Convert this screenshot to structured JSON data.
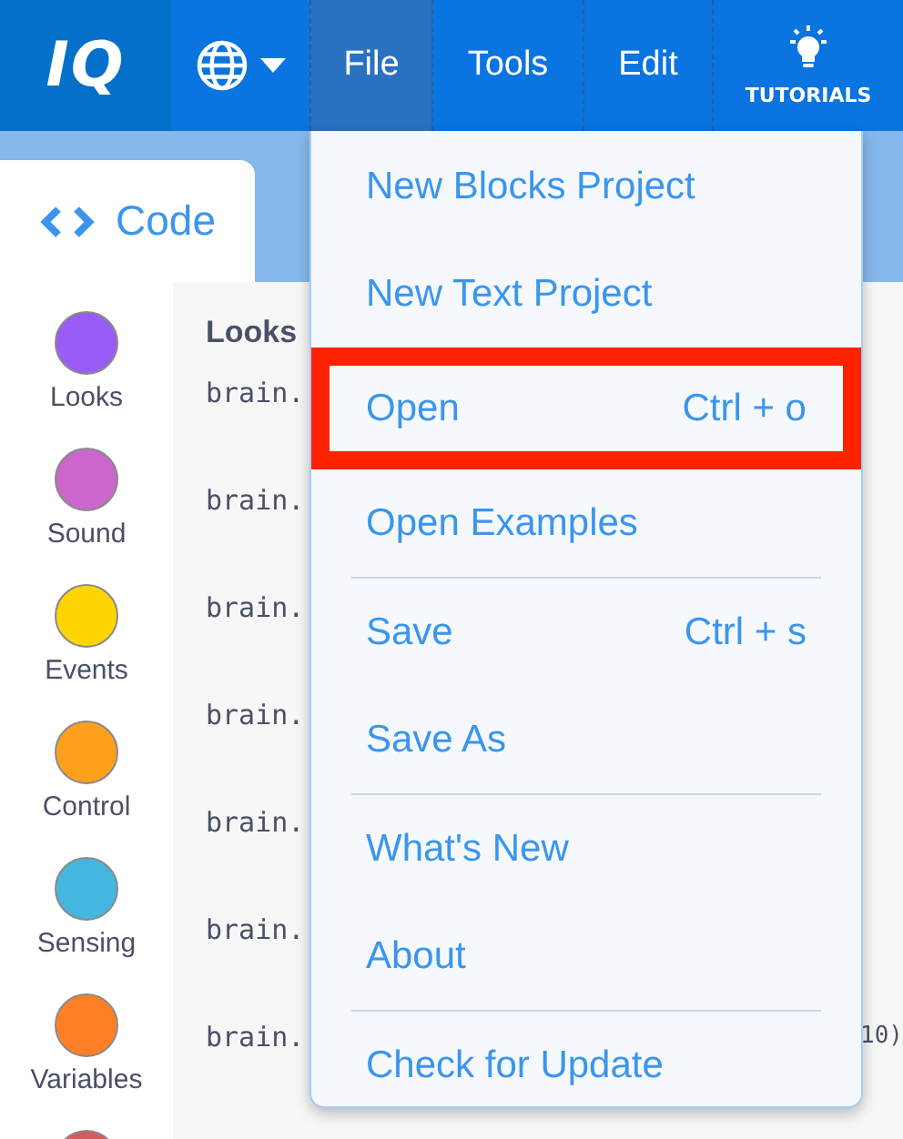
{
  "top_bar": {
    "logo": "IQ",
    "menus": [
      {
        "label": "File",
        "selected": true
      },
      {
        "label": "Tools",
        "selected": false
      },
      {
        "label": "Edit",
        "selected": false
      }
    ],
    "tutorials": "TUTORIALS"
  },
  "code_tab": {
    "label": "Code"
  },
  "categories": [
    {
      "label": "Looks",
      "color": "#9a5cf7"
    },
    {
      "label": "Sound",
      "color": "#cc66cc"
    },
    {
      "label": "Events",
      "color": "#ffd500"
    },
    {
      "label": "Control",
      "color": "#ffa01c"
    },
    {
      "label": "Sensing",
      "color": "#44b6e0"
    },
    {
      "label": "Variables",
      "color": "#ff8024"
    },
    {
      "color": "#d65c5c"
    }
  ],
  "code_panel": {
    "heading": "Looks",
    "lines": [
      {
        "start": "brain."
      },
      {
        "start": "brain."
      },
      {
        "start": "brain."
      },
      {
        "start": "brain."
      },
      {
        "start": "brain."
      },
      {
        "start": "brain."
      },
      {
        "start": "brain.",
        "end": "10)"
      }
    ]
  },
  "file_menu": {
    "sections": [
      [
        {
          "label": "New Blocks Project",
          "selected": false
        },
        {
          "label": "New Text Project",
          "selected": false
        },
        {
          "label": "Open",
          "shortcut": "Ctrl + o",
          "selected": true
        },
        {
          "label": "Open Examples",
          "selected": false
        }
      ],
      [
        {
          "label": "Save",
          "shortcut": "Ctrl + s",
          "selected": false
        },
        {
          "label": "Save As",
          "selected": false
        }
      ],
      [
        {
          "label": "What's New",
          "selected": false
        },
        {
          "label": "About",
          "selected": false
        }
      ],
      [
        {
          "label": "Check for Update",
          "selected": false
        }
      ]
    ]
  }
}
